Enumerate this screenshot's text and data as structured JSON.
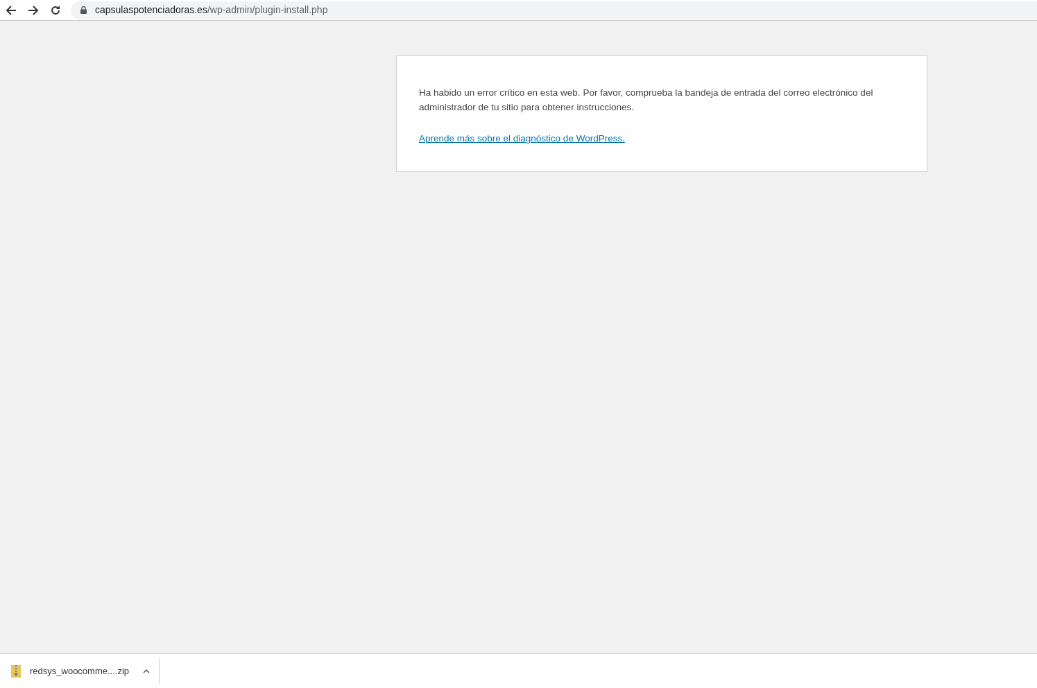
{
  "address_bar": {
    "domain": "capsulaspotenciadoras.es",
    "path": "/wp-admin/plugin-install.php"
  },
  "error_box": {
    "message": "Ha habido un error crítico en esta web. Por favor, comprueba la bandeja de entrada del correo electrónico del administrador de tu sitio para obtener instrucciones.",
    "link": "Aprende más sobre el diagnóstico de WordPress."
  },
  "download_bar": {
    "items": [
      {
        "filename": "redsys_woocomme....zip"
      }
    ]
  }
}
